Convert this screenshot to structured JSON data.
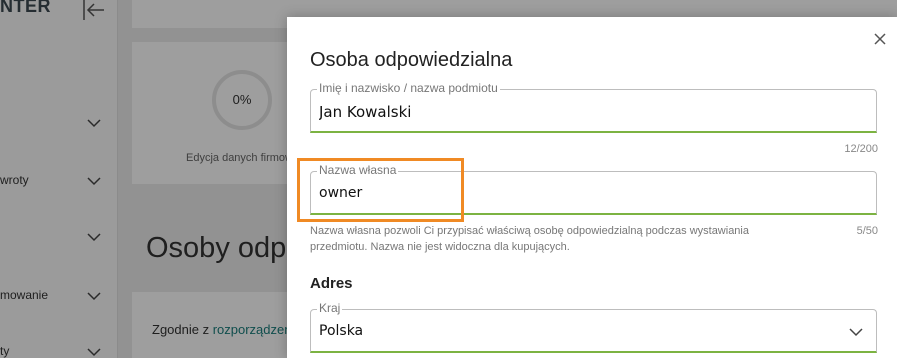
{
  "sidebar": {
    "brand": "NTER",
    "items": [
      {
        "label": ""
      },
      {
        "label": "wroty"
      },
      {
        "label": ""
      },
      {
        "label": "mowanie"
      },
      {
        "label": "ty"
      }
    ]
  },
  "main": {
    "progress": {
      "value": "0%",
      "caption": "Edycja danych firmowych"
    },
    "section_heading": "Osoby odpowiedzialne",
    "compliance": {
      "prefix": "Zgodnie z ",
      "link": "rozporządzeniem"
    }
  },
  "modal": {
    "title": "Osoba odpowiedzialna",
    "name_field": {
      "legend": "Imię i nazwisko / nazwa podmiotu",
      "value": "Jan Kowalski",
      "counter": "12/200"
    },
    "own_name_field": {
      "legend": "Nazwa własna",
      "value": "owner",
      "counter": "5/50"
    },
    "helper_text": "Nazwa własna pozwoli Ci przypisać właściwą osobę odpowiedzialną podczas wystawiania przedmiotu. Nazwa nie jest widoczna dla kupujących.",
    "address_heading": "Adres",
    "country_field": {
      "legend": "Kraj",
      "value": "Polska"
    }
  },
  "colors": {
    "accent_green": "#7cb342",
    "highlight_orange": "#f08a24",
    "link_teal": "#1a7e7c"
  },
  "icons": {
    "close": "close-icon",
    "collapse": "collapse-sidebar-icon",
    "chevron": "chevron-down-icon"
  }
}
